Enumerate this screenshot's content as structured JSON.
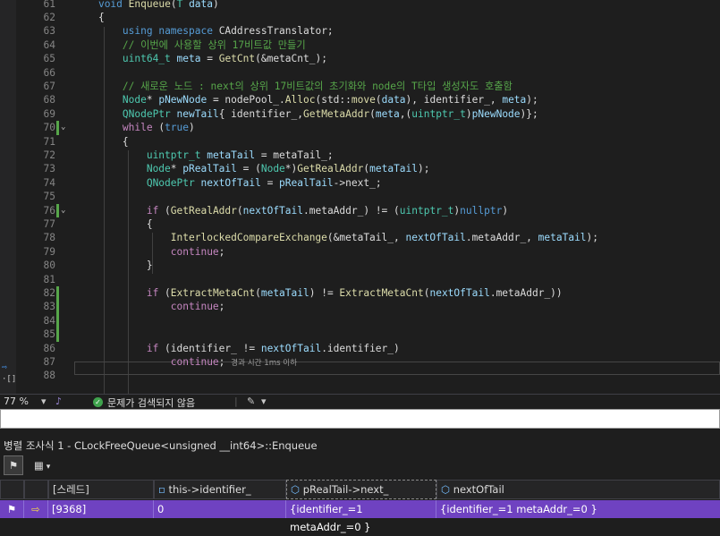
{
  "editor": {
    "lines": [
      {
        "n": "61",
        "fold": "",
        "changed": false,
        "code": [
          [
            "    ",
            ""
          ],
          [
            "void",
            "kw"
          ],
          [
            " ",
            ""
          ],
          [
            "Enqueue",
            "fn"
          ],
          [
            "(",
            ""
          ],
          [
            "T",
            "ty"
          ],
          [
            " ",
            ""
          ],
          [
            "data",
            "var"
          ],
          [
            ")",
            ""
          ]
        ]
      },
      {
        "n": "62",
        "fold": "",
        "changed": false,
        "code": [
          [
            "    {",
            ""
          ]
        ]
      },
      {
        "n": "63",
        "fold": "",
        "changed": false,
        "code": [
          [
            "        ",
            ""
          ],
          [
            "using",
            "kw"
          ],
          [
            " ",
            ""
          ],
          [
            "namespace",
            "kw"
          ],
          [
            " CAddressTranslator;",
            ""
          ]
        ]
      },
      {
        "n": "64",
        "fold": "",
        "changed": false,
        "code": [
          [
            "        ",
            ""
          ],
          [
            "// 이번에 사용할 상위 17비트값 만들기",
            "cm"
          ]
        ]
      },
      {
        "n": "65",
        "fold": "",
        "changed": false,
        "code": [
          [
            "        ",
            ""
          ],
          [
            "uint64_t",
            "ty"
          ],
          [
            " ",
            ""
          ],
          [
            "meta",
            "var"
          ],
          [
            " = ",
            ""
          ],
          [
            "GetCnt",
            "fn"
          ],
          [
            "(&metaCnt_);",
            ""
          ]
        ]
      },
      {
        "n": "66",
        "fold": "",
        "changed": false,
        "code": [
          [
            "",
            ""
          ]
        ]
      },
      {
        "n": "67",
        "fold": "",
        "changed": false,
        "code": [
          [
            "        ",
            ""
          ],
          [
            "// 새로운 노드 : next의 상위 17비트값의 초기화와 node의 T타입 생성자도 호출함",
            "cm"
          ]
        ]
      },
      {
        "n": "68",
        "fold": "",
        "changed": false,
        "code": [
          [
            "        ",
            ""
          ],
          [
            "Node",
            "ty"
          ],
          [
            "* ",
            ""
          ],
          [
            "pNewNode",
            "var"
          ],
          [
            " = nodePool_.",
            ""
          ],
          [
            "Alloc",
            "fn"
          ],
          [
            "(std::",
            ""
          ],
          [
            "move",
            "fn"
          ],
          [
            "(",
            ""
          ],
          [
            "data",
            "var"
          ],
          [
            "), identifier_, ",
            ""
          ],
          [
            "meta",
            "var"
          ],
          [
            ");",
            ""
          ]
        ]
      },
      {
        "n": "69",
        "fold": "",
        "changed": false,
        "code": [
          [
            "        ",
            ""
          ],
          [
            "QNodePtr",
            "ty"
          ],
          [
            " ",
            ""
          ],
          [
            "newTail",
            "var"
          ],
          [
            "{ identifier_,",
            ""
          ],
          [
            "GetMetaAddr",
            "fn"
          ],
          [
            "(",
            ""
          ],
          [
            "meta",
            "var"
          ],
          [
            ",(",
            ""
          ],
          [
            "uintptr_t",
            "ty"
          ],
          [
            ")",
            ""
          ],
          [
            "pNewNode",
            "var"
          ],
          [
            ")};",
            ""
          ]
        ]
      },
      {
        "n": "70",
        "fold": "⌄",
        "changed": true,
        "code": [
          [
            "        ",
            ""
          ],
          [
            "while",
            "mac"
          ],
          [
            " (",
            ""
          ],
          [
            "true",
            "kw"
          ],
          [
            ")",
            ""
          ]
        ]
      },
      {
        "n": "71",
        "fold": "",
        "changed": false,
        "code": [
          [
            "        {",
            ""
          ]
        ]
      },
      {
        "n": "72",
        "fold": "",
        "changed": false,
        "code": [
          [
            "            ",
            ""
          ],
          [
            "uintptr_t",
            "ty"
          ],
          [
            " ",
            ""
          ],
          [
            "metaTail",
            "var"
          ],
          [
            " = metaTail_;",
            ""
          ]
        ]
      },
      {
        "n": "73",
        "fold": "",
        "changed": false,
        "code": [
          [
            "            ",
            ""
          ],
          [
            "Node",
            "ty"
          ],
          [
            "* ",
            ""
          ],
          [
            "pRealTail",
            "var"
          ],
          [
            " = (",
            ""
          ],
          [
            "Node",
            "ty"
          ],
          [
            "*)",
            ""
          ],
          [
            "GetRealAddr",
            "fn"
          ],
          [
            "(",
            ""
          ],
          [
            "metaTail",
            "var"
          ],
          [
            ");",
            ""
          ]
        ]
      },
      {
        "n": "74",
        "fold": "",
        "changed": false,
        "code": [
          [
            "            ",
            ""
          ],
          [
            "QNodePtr",
            "ty"
          ],
          [
            " ",
            ""
          ],
          [
            "nextOfTail",
            "var"
          ],
          [
            " = ",
            ""
          ],
          [
            "pRealTail",
            "var"
          ],
          [
            "->next_;",
            ""
          ]
        ]
      },
      {
        "n": "75",
        "fold": "",
        "changed": false,
        "code": [
          [
            "",
            ""
          ]
        ]
      },
      {
        "n": "76",
        "fold": "⌄",
        "changed": true,
        "code": [
          [
            "            ",
            ""
          ],
          [
            "if",
            "mac"
          ],
          [
            " (",
            ""
          ],
          [
            "GetRealAddr",
            "fn"
          ],
          [
            "(",
            ""
          ],
          [
            "nextOfTail",
            "var"
          ],
          [
            ".metaAddr_) != (",
            ""
          ],
          [
            "uintptr_t",
            "ty"
          ],
          [
            ")",
            ""
          ],
          [
            "nullptr",
            "kw"
          ],
          [
            ")",
            ""
          ]
        ]
      },
      {
        "n": "77",
        "fold": "",
        "changed": false,
        "code": [
          [
            "            {",
            ""
          ]
        ]
      },
      {
        "n": "78",
        "fold": "",
        "changed": false,
        "code": [
          [
            "                ",
            ""
          ],
          [
            "InterlockedCompareExchange",
            "fn"
          ],
          [
            "(&metaTail_, ",
            ""
          ],
          [
            "nextOfTail",
            "var"
          ],
          [
            ".metaAddr_, ",
            ""
          ],
          [
            "metaTail",
            "var"
          ],
          [
            ");",
            ""
          ]
        ]
      },
      {
        "n": "79",
        "fold": "",
        "changed": false,
        "code": [
          [
            "                ",
            ""
          ],
          [
            "continue",
            "mac"
          ],
          [
            ";",
            ""
          ]
        ]
      },
      {
        "n": "80",
        "fold": "",
        "changed": false,
        "code": [
          [
            "            }",
            ""
          ]
        ]
      },
      {
        "n": "81",
        "fold": "",
        "changed": false,
        "code": [
          [
            "",
            ""
          ]
        ]
      },
      {
        "n": "82",
        "fold": "",
        "changed": true,
        "code": [
          [
            "            ",
            ""
          ],
          [
            "if",
            "mac"
          ],
          [
            " (",
            ""
          ],
          [
            "ExtractMetaCnt",
            "fn"
          ],
          [
            "(",
            ""
          ],
          [
            "metaTail",
            "var"
          ],
          [
            ") != ",
            ""
          ],
          [
            "ExtractMetaCnt",
            "fn"
          ],
          [
            "(",
            ""
          ],
          [
            "nextOfTail",
            "var"
          ],
          [
            ".metaAddr_))",
            ""
          ]
        ]
      },
      {
        "n": "83",
        "fold": "",
        "changed": true,
        "code": [
          [
            "                ",
            ""
          ],
          [
            "continue",
            "mac"
          ],
          [
            ";",
            ""
          ]
        ]
      },
      {
        "n": "84",
        "fold": "",
        "changed": true,
        "code": [
          [
            "",
            ""
          ]
        ]
      },
      {
        "n": "85",
        "fold": "",
        "changed": true,
        "code": [
          [
            "",
            ""
          ]
        ]
      },
      {
        "n": "86",
        "fold": "",
        "changed": false,
        "code": [
          [
            "            ",
            ""
          ],
          [
            "if",
            "mac"
          ],
          [
            " (identifier_ != ",
            ""
          ],
          [
            "nextOfTail",
            "var"
          ],
          [
            ".identifier_)",
            ""
          ]
        ]
      },
      {
        "n": "87",
        "fold": "",
        "changed": false,
        "current": true,
        "code": [
          [
            "                ",
            ""
          ],
          [
            "continue",
            "mac"
          ],
          [
            ";",
            ""
          ]
        ],
        "hint": "경과 시간 1ms 이하"
      },
      {
        "n": "88",
        "fold": "",
        "changed": false,
        "code": [
          [
            "",
            ""
          ]
        ]
      }
    ]
  },
  "status": {
    "zoom": "77 %",
    "issues": "문제가 검색되지 않음"
  },
  "parallel_watch": {
    "title": "병렬 조사식 1 - CLockFreeQueue<unsigned __int64>::Enqueue",
    "headers": [
      "[스레드]",
      "this->identifier_",
      "pRealTail->next_",
      "nextOfTail"
    ],
    "rows": [
      {
        "thread": "[9368]",
        "identifier": "0",
        "next": "{identifier_=1 metaAddr_=0 }",
        "nextOfTail": "{identifier_=1 metaAddr_=0 }"
      }
    ]
  },
  "colors": {
    "accent": "#6f42c1",
    "editor_bg": "#1e1e1e",
    "change_bar": "#57a64a"
  }
}
